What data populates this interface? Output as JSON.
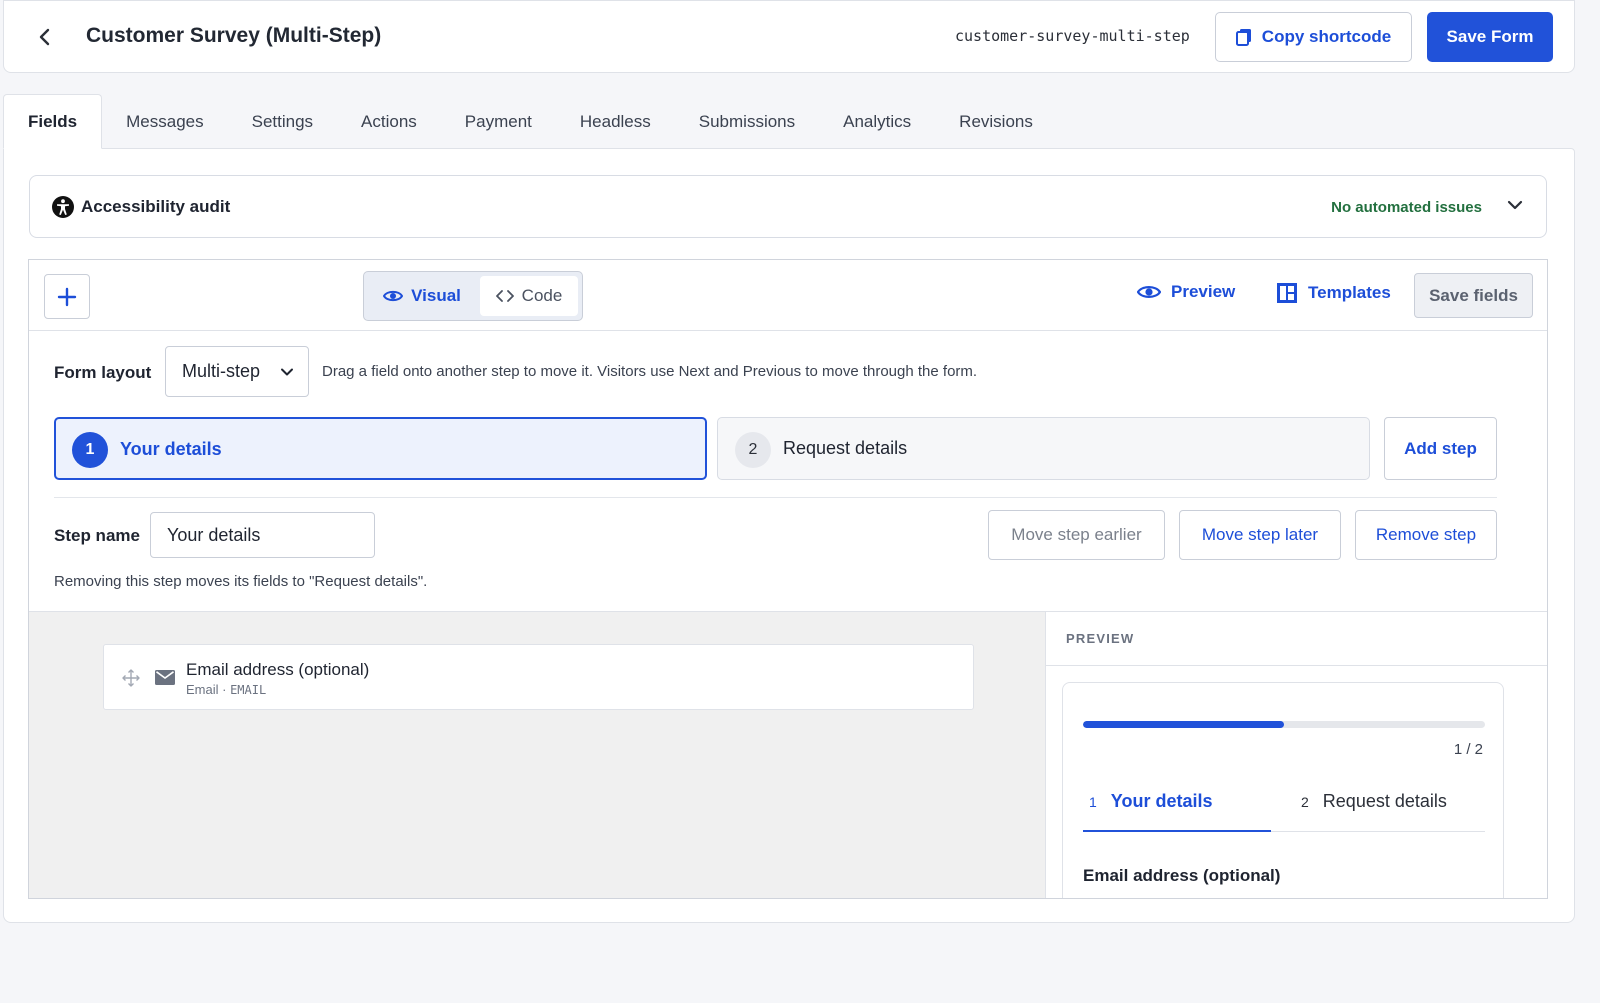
{
  "header": {
    "title": "Customer Survey (Multi-Step)",
    "slug": "customer-survey-multi-step",
    "copy_shortcode_label": "Copy shortcode",
    "save_form_label": "Save Form"
  },
  "tabs": [
    {
      "label": "Fields",
      "active": true
    },
    {
      "label": "Messages"
    },
    {
      "label": "Settings"
    },
    {
      "label": "Actions"
    },
    {
      "label": "Payment"
    },
    {
      "label": "Headless"
    },
    {
      "label": "Submissions"
    },
    {
      "label": "Analytics"
    },
    {
      "label": "Revisions"
    }
  ],
  "audit": {
    "title": "Accessibility audit",
    "status": "No automated issues",
    "status_color": "#23703f"
  },
  "toolbar": {
    "mode_visual": "Visual",
    "mode_code": "Code",
    "preview_label": "Preview",
    "templates_label": "Templates",
    "save_fields_label": "Save fields"
  },
  "layout": {
    "label": "Form layout",
    "selected": "Multi-step",
    "help": "Drag a field onto another step to move it. Visitors use Next and Previous to move through the form."
  },
  "steps": [
    {
      "number": "1",
      "name": "Your details",
      "active": true
    },
    {
      "number": "2",
      "name": "Request details"
    }
  ],
  "add_step_label": "Add step",
  "step_editor": {
    "label": "Step name",
    "value": "Your details",
    "move_earlier": "Move step earlier",
    "move_later": "Move step later",
    "remove": "Remove step",
    "remove_help": "Removing this step moves its fields to \"Request details\"."
  },
  "fields": [
    {
      "label": "Email address (optional)",
      "type": "Email",
      "separator": " · ",
      "key": "EMAIL"
    }
  ],
  "preview": {
    "heading": "PREVIEW",
    "progress_fraction": 0.5,
    "progress_text": "1 / 2",
    "field_label": "Email address (optional)"
  },
  "colors": {
    "accent": "#2152d9",
    "link": "#1d4ed8",
    "success": "#23703f"
  }
}
